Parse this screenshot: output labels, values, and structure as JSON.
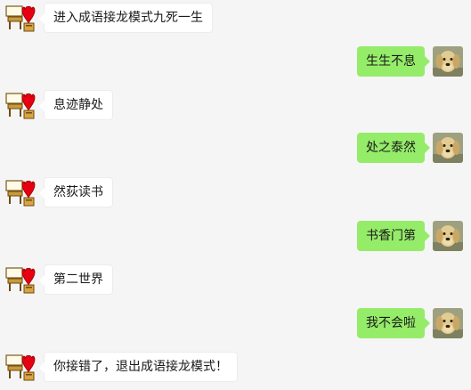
{
  "colors": {
    "background": "#f5f5f5",
    "incoming_bubble": "#ffffff",
    "outgoing_bubble": "#95ec69"
  },
  "messages": [
    {
      "side": "left",
      "avatar": "heart-desk-bot-icon",
      "text": "进入成语接龙模式九死一生"
    },
    {
      "side": "right",
      "avatar": "dog-photo-avatar",
      "text": "生生不息"
    },
    {
      "side": "left",
      "avatar": "heart-desk-bot-icon",
      "text": "息迹静处"
    },
    {
      "side": "right",
      "avatar": "dog-photo-avatar",
      "text": "处之泰然"
    },
    {
      "side": "left",
      "avatar": "heart-desk-bot-icon",
      "text": "然荻读书"
    },
    {
      "side": "right",
      "avatar": "dog-photo-avatar",
      "text": "书香门第"
    },
    {
      "side": "left",
      "avatar": "heart-desk-bot-icon",
      "text": "第二世界"
    },
    {
      "side": "right",
      "avatar": "dog-photo-avatar",
      "text": "我不会啦"
    },
    {
      "side": "left",
      "avatar": "heart-desk-bot-icon",
      "text": "你接错了，退出成语接龙模式！"
    }
  ]
}
